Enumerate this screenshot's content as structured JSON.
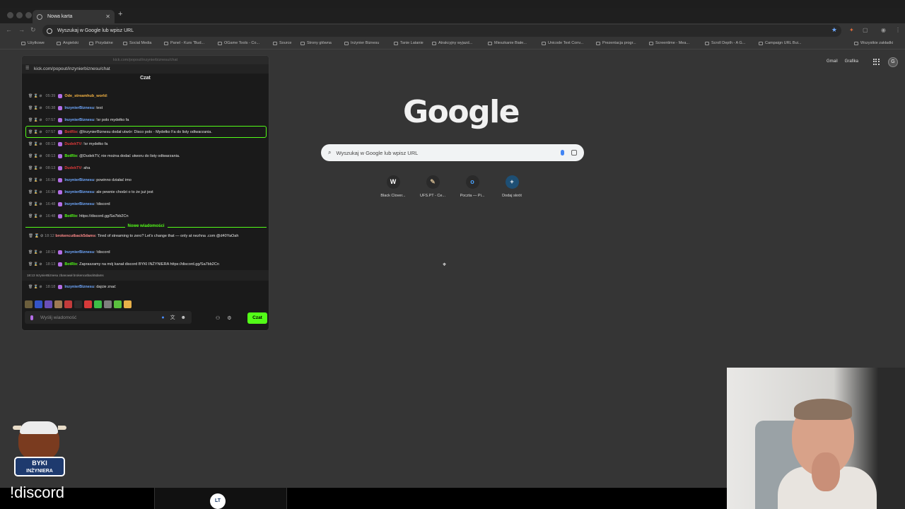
{
  "browser": {
    "tab_title": "Nowa karta",
    "url": "Wyszukaj w Google lub wpisz URL",
    "bookmarks": [
      "Użytkowe",
      "Angielski",
      "Przydatne",
      "Social Media",
      "Panel - Kurs \"Bud...",
      "OGame Tools - Co...",
      "Source",
      "Strony główna",
      "Inżynier Biznesu",
      "Tanie Latanie",
      "Atrakcyjny wyjazd...",
      "Mieszkanie Białe...",
      "Unicode Text Conv...",
      "Prezentacja progr...",
      "Screentime - Mea...",
      "Scroll Depth - A G...",
      "Campaign URL Bui...",
      "Wszystkie zakładki"
    ]
  },
  "google": {
    "links": [
      "Gmail",
      "Grafika"
    ],
    "account_initial": "G",
    "logo": "Google",
    "search_placeholder": "Wyszukaj w Google lub wpisz URL",
    "shortcuts": [
      {
        "icon": "W",
        "label": "Black Clover..."
      },
      {
        "icon": "✎",
        "label": "UFS.PT - Ce..."
      },
      {
        "icon": "o",
        "label": "Poczta — Pi..."
      },
      {
        "icon": "+",
        "label": "Dodaj skrót"
      }
    ]
  },
  "chat": {
    "window_title": "kick.com/popout/inzynierbiznesu/chat",
    "url": "kick.com/popout/inzynierbiznesu/chat",
    "header": "Czat",
    "messages": [
      {
        "time": "05:39",
        "user": "Ode_streamhub_world",
        "text": "",
        "user_color": "#f5b342"
      },
      {
        "time": "06:38",
        "user": "InzynierBiznesu",
        "text": "test",
        "user_color": "#6fa8ff"
      },
      {
        "time": "07:57",
        "user": "InzynierBiznesu",
        "text": "!sr polo mydełko fa",
        "user_color": "#6fa8ff"
      },
      {
        "time": "07:57",
        "user": "BotRix",
        "text": "@InzynierBiznesu dodał utwór: Disco polo - Mydełko Fa do listy odtwarzania.",
        "user_color": "#e03a3a"
      },
      {
        "time": "08:13",
        "user": "DudekTV",
        "text": "!sr mydełko fa",
        "user_color": "#e03a3a"
      },
      {
        "time": "08:13",
        "user": "BotRix",
        "text": "@DudekTV, nie można dodać utworu do listy odtwarzania.",
        "user_color": "#53fc18"
      },
      {
        "time": "08:13",
        "user": "DudekTV",
        "text": "aha",
        "user_color": "#e03a3a"
      },
      {
        "time": "16:38",
        "user": "InzynierBiznesu",
        "text": "powinno działać imo",
        "user_color": "#6fa8ff"
      },
      {
        "time": "16:38",
        "user": "InzynierBiznesu",
        "text": "ale pewnie chodzi o to że już jest",
        "user_color": "#6fa8ff"
      },
      {
        "time": "16:48",
        "user": "InzynierBiznesu",
        "text": "!discord",
        "user_color": "#6fa8ff"
      },
      {
        "time": "16:48",
        "user": "BotRix",
        "text": "https://discord.gg/Sa7bb2Cn",
        "user_color": "#53fc18"
      }
    ],
    "new_messages_label": "Nowe wiadomości",
    "messages_after": [
      {
        "time": "18:12",
        "user": "brokencutback5dams",
        "text": "Tired of streaming to zero? Let's change that — only at nezhna .com @d40YaOah",
        "user_color": "#ff8a8a"
      },
      {
        "time": "18:13",
        "user": "InzynierBiznesu",
        "text": "!discord",
        "user_color": "#6fa8ff"
      },
      {
        "time": "18:13",
        "user": "BotRix",
        "text": "Zapraszamy na mój kanał discord BYKI INŻYNIERA https://discord.gg/Sa7bb2Cn",
        "user_color": "#53fc18"
      }
    ],
    "ban_notice": {
      "time": "18:13",
      "text": "InzynierBiznesu zbanował brokencutback5dams"
    },
    "last_message": {
      "time": "18:18",
      "user": "InzynierBiznesu",
      "text": "dajcie znać",
      "user_color": "#6fa8ff"
    },
    "input_placeholder": "Wyślij wiadomość",
    "send_label": "Czat",
    "accent_color": "#53fc18"
  },
  "overlay": {
    "badge_line1": "BYKI",
    "badge_line2": "INŻYNIERA",
    "command_text": "!discord",
    "dock_logo": "LT"
  }
}
